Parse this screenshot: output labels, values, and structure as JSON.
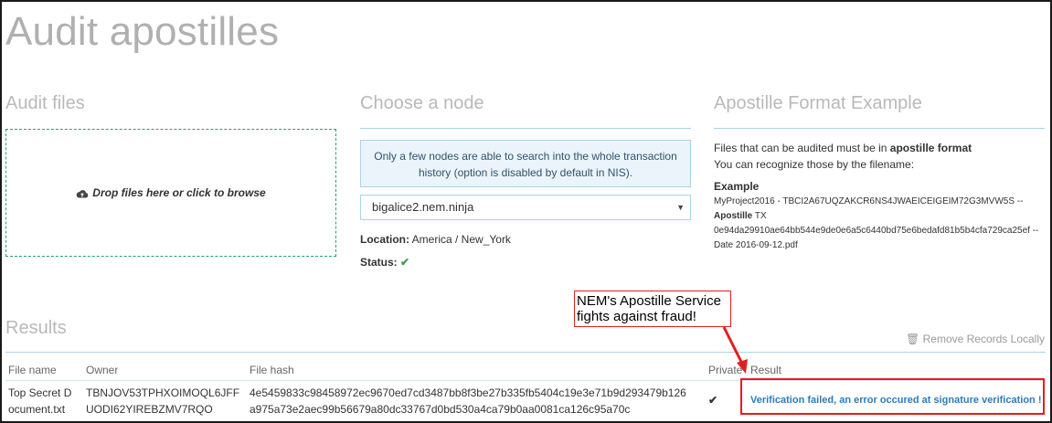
{
  "page": {
    "title": "Audit apostilles"
  },
  "audit_files": {
    "heading": "Audit files",
    "dropzone_label": "Drop files here or click to browse"
  },
  "node": {
    "heading": "Choose a node",
    "info": "Only a few nodes are able to search into the whole transaction history (option is disabled by default in NIS).",
    "selected": "bigalice2.nem.ninja",
    "location_label": "Location:",
    "location_value": "America / New_York",
    "status_label": "Status:",
    "status_value": "✔"
  },
  "format": {
    "heading": "Apostille Format Example",
    "line1_prefix": "Files that can be audited must be in ",
    "line1_bold": "apostille format",
    "line2": "You can recognize those by the filename:",
    "example_label": "Example",
    "ex_line1": "MyProject2016 - TBCI2A67UQZAKCR6NS4JWAEICEIGEIM72G3MVW5S --",
    "ex_apostille": "Apostille",
    "ex_tx": " TX",
    "ex_line3": "0e94da29910ae64bb544e9de0e6a5c6440bd75e6bedafd81b5b4cfa729ca25ef --",
    "ex_line4": "Date 2016-09-12.pdf"
  },
  "results": {
    "heading": "Results",
    "remove_label": "Remove Records Locally",
    "columns": [
      "File name",
      "Owner",
      "File hash",
      "Private",
      "Result"
    ],
    "row": {
      "file_name_1": "Top Secret D",
      "file_name_2": "ocument.txt",
      "owner_1": "TBNJOV53TPHXOIMOQL6JFF",
      "owner_2": "UODI62YIREBZMV7RQO",
      "hash_1": "4e5459833c98458972ec9670ed7cd3487bb8f3be27b335fb5404c19e3e71b9d293479b126",
      "hash_2": "a975a73e2aec99b56679a80dc33767d0bd530a4ca79b0aa0081ca126c95a70c",
      "private": "✔",
      "result": "Verification failed, an error occured at signature verification !"
    }
  },
  "callout": {
    "line1": "NEM's Apostille Service",
    "line2": "fights against fraud!"
  },
  "colors": {
    "accent_rule": "#a9d4e6",
    "success": "#3aa14a",
    "link": "#2c7bbf",
    "annotation_red": "#e02020"
  }
}
